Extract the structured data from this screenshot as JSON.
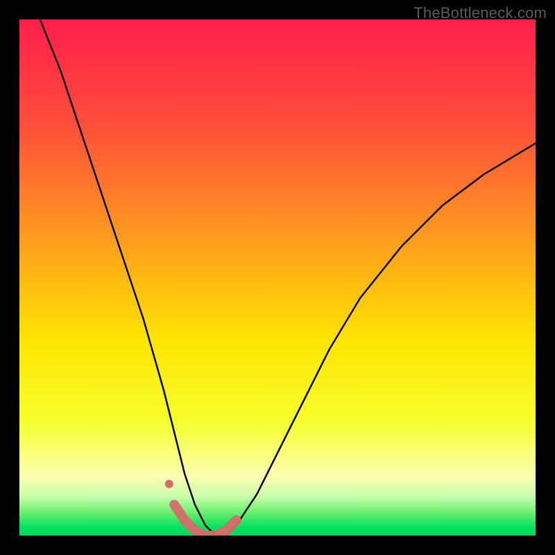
{
  "watermark": "TheBottleneck.com",
  "chart_data": {
    "type": "line",
    "title": "",
    "xlabel": "",
    "ylabel": "",
    "xlim": [
      0,
      100
    ],
    "ylim": [
      0,
      100
    ],
    "grid": false,
    "legend": false,
    "gradient_stops": [
      {
        "offset": 0,
        "color": "#ff1f4b"
      },
      {
        "offset": 0.2,
        "color": "#ff4d3a"
      },
      {
        "offset": 0.42,
        "color": "#ff9a1f"
      },
      {
        "offset": 0.62,
        "color": "#ffe400"
      },
      {
        "offset": 0.78,
        "color": "#f6ff2e"
      },
      {
        "offset": 0.885,
        "color": "#fbffb0"
      },
      {
        "offset": 0.925,
        "color": "#c6ffac"
      },
      {
        "offset": 0.955,
        "color": "#6af06e"
      },
      {
        "offset": 0.985,
        "color": "#00e060"
      },
      {
        "offset": 1.0,
        "color": "#00d85a"
      }
    ],
    "series": [
      {
        "name": "bottleneck-curve",
        "color": "#000000",
        "stroke_width": 2.5,
        "x": [
          4,
          8,
          12,
          16,
          20,
          24,
          28,
          30,
          32,
          34,
          36,
          38,
          40,
          42,
          46,
          50,
          55,
          60,
          66,
          74,
          82,
          90,
          100
        ],
        "y": [
          100,
          90,
          78,
          66,
          54,
          42,
          28,
          20,
          12,
          6,
          2,
          0,
          0,
          2,
          8,
          16,
          26,
          36,
          46,
          56,
          64,
          70,
          76
        ]
      }
    ],
    "highlight": {
      "name": "bottom-band",
      "color": "#d86a6a",
      "stroke_width": 14,
      "cap": "round",
      "x": [
        30,
        32,
        34,
        36,
        38,
        40,
        42
      ],
      "y": [
        6,
        3,
        1,
        0,
        0,
        1,
        3
      ]
    },
    "highlight_dot": {
      "name": "marker-dot",
      "color": "#d86a6a",
      "radius": 6,
      "x": 29,
      "y": 10
    }
  }
}
